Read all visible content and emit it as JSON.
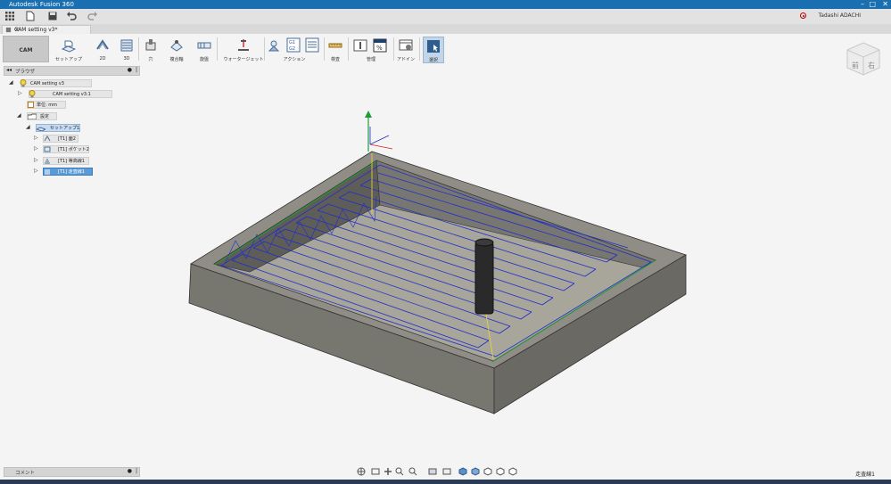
{
  "app": {
    "title": "Autodesk Fusion 360",
    "document_tab": "CAM setting v3*",
    "user": "Tadashi ADACHI"
  },
  "workspace": {
    "label": "CAM"
  },
  "toolbar": {
    "tools": [
      {
        "label": "セットアップ"
      },
      {
        "label": "2D"
      },
      {
        "label": "3D"
      },
      {
        "label": "穴"
      },
      {
        "label": "複合軸"
      },
      {
        "label": "旋盤"
      },
      {
        "label": "ウォータージェット"
      },
      {
        "label": "アクション"
      },
      {
        "label": "検査"
      },
      {
        "label": "管理"
      },
      {
        "label": "アドイン"
      },
      {
        "label": "選択"
      }
    ]
  },
  "browser": {
    "title": "ブラウザ",
    "items": [
      {
        "label": "CAM setting v3"
      },
      {
        "label": "CAM setting v3:1"
      },
      {
        "label": "単位: mm"
      },
      {
        "label": "設定"
      },
      {
        "label": "セットアップ1"
      },
      {
        "label": "[T1] 面2"
      },
      {
        "label": "[T1] ポケット2"
      },
      {
        "label": "[T1] 等高線1"
      },
      {
        "label": "[T1] 走査線1"
      }
    ]
  },
  "comments": {
    "label": "コメント"
  },
  "viewcube": {
    "front": "前",
    "right": "右"
  },
  "status": {
    "selection": "走査線1"
  },
  "colors": {
    "titlebar": "#1a6fb0",
    "toolpath": "#1f2ecc",
    "stock": "#7a7870",
    "accent_green": "#1f9c35"
  }
}
